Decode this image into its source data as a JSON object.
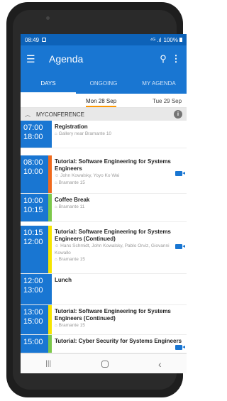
{
  "status": {
    "time": "08:49",
    "signal": "⁴ᴳ .ıl",
    "battery": "100%"
  },
  "appbar": {
    "title": "Agenda",
    "menu_icon": "menu-icon",
    "search_icon": "search-icon",
    "more_icon": "more-vert-icon"
  },
  "tabs": [
    {
      "label": "Days",
      "active": true
    },
    {
      "label": "Ongoing",
      "active": false
    },
    {
      "label": "My Agenda",
      "active": false
    }
  ],
  "dates": {
    "selected": "Mon 28 Sep",
    "next": "Tue 29 Sep"
  },
  "conference": {
    "name": "MYCONFERENCE"
  },
  "sessions": [
    {
      "start": "07:00",
      "end": "18:00",
      "title": "Registration",
      "speakers": "",
      "location": "Gallery near Bramante 10",
      "strip_color": "#1976d2",
      "video": false
    },
    {
      "start": "08:00",
      "end": "10:00",
      "title": "Tutorial: Software Engineering for Systems Engineers",
      "speakers": "John Kowalsky, Yoyo Ko Wai",
      "location": "Bramante 15",
      "strip_color": "#f06a1d",
      "video": true
    },
    {
      "start": "10:00",
      "end": "10:15",
      "title": "Coffee Break",
      "speakers": "",
      "location": "Bramante 11",
      "strip_color": "#7cc84a",
      "video": false
    },
    {
      "start": "10:15",
      "end": "12:00",
      "title": "Tutorial: Software Engineering for Systems Engineers (Continued)",
      "speakers": "Hans Schmidt, John Kowalsky, Pablo Orviz, Giovanni Kowallo",
      "location": "Bramante 15",
      "strip_color": "#f5e400",
      "video": true
    },
    {
      "start": "12:00",
      "end": "13:00",
      "title": "Lunch",
      "speakers": "",
      "location": "",
      "strip_color": "#1976d2",
      "video": false
    },
    {
      "start": "13:00",
      "end": "15:00",
      "title": "Tutorial: Software Engineering for Systems Engineers (Continued)",
      "speakers": "",
      "location": "Bramante 15",
      "strip_color": "#f5e400",
      "video": false
    },
    {
      "start": "15:00",
      "end": "",
      "title": "Tutorial: Cyber Security for Systems Engineers",
      "speakers": "",
      "location": "",
      "strip_color": "#7cc84a",
      "video": true
    }
  ],
  "navbar": {
    "recents": "|||",
    "back": "‹"
  }
}
